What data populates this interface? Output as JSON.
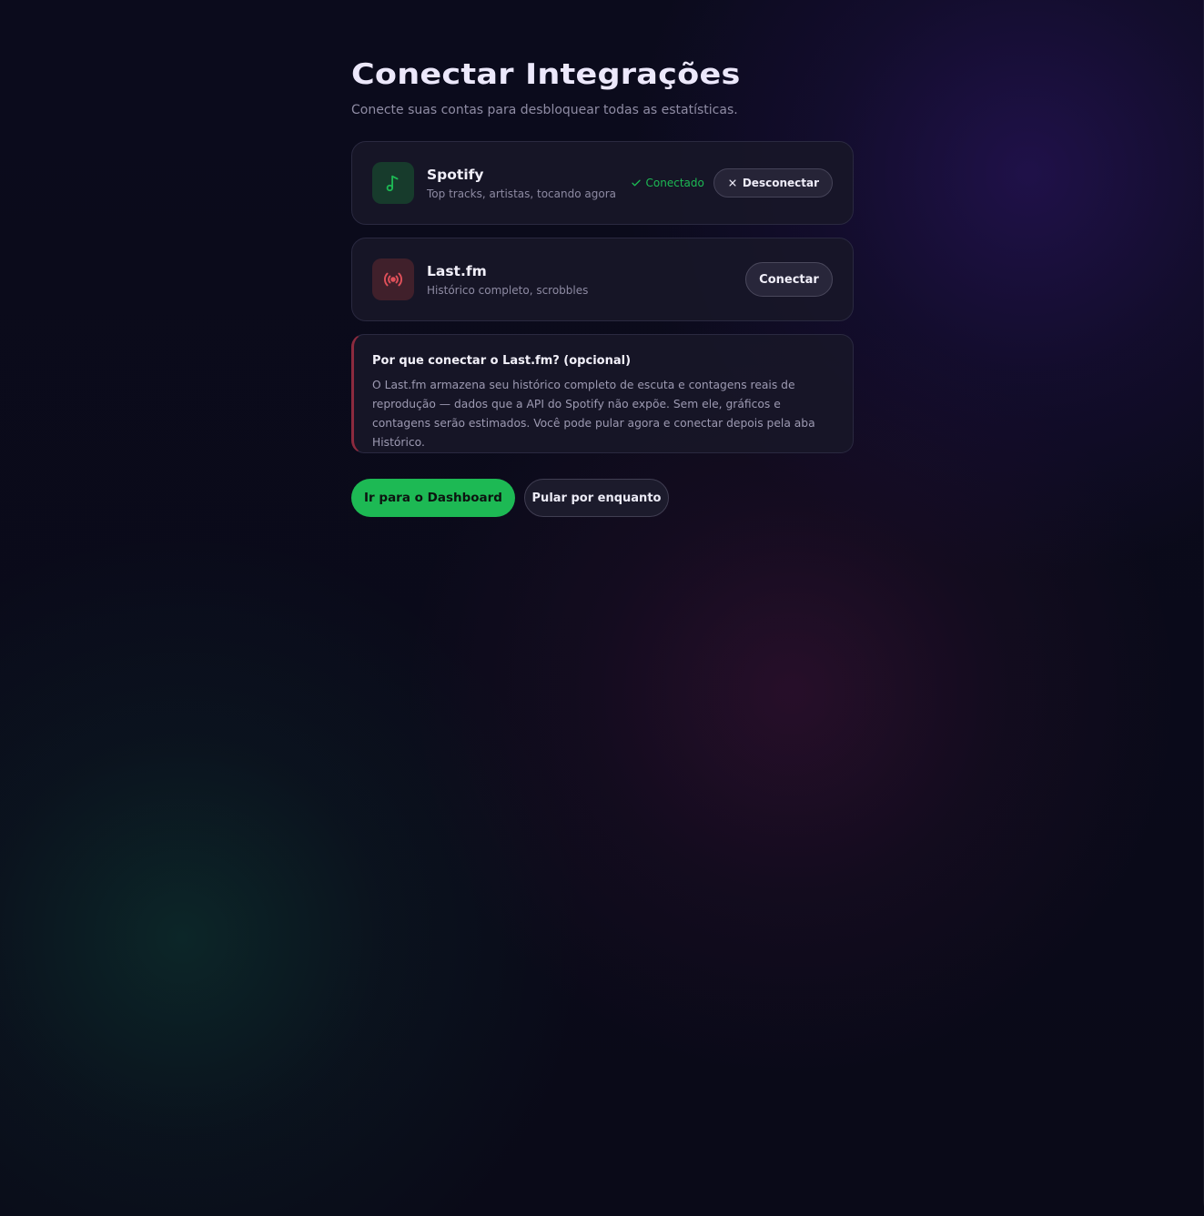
{
  "header": {
    "title": "Conectar Integrações",
    "subtitle": "Conecte suas contas para desbloquear todas as estatísticas."
  },
  "integrations": [
    {
      "name": "Spotify",
      "description": "Top tracks, artistas, tocando agora",
      "icon": "music-note-icon",
      "accent": "#1db954",
      "connected": true,
      "status_label": "Conectado",
      "action_label": "Desconectar"
    },
    {
      "name": "Last.fm",
      "description": "Histórico completo, scrobbles",
      "icon": "broadcast-icon",
      "accent": "#e0505a",
      "connected": false,
      "action_label": "Conectar"
    }
  ],
  "info": {
    "title": "Por que conectar o Last.fm? (opcional)",
    "body": "O Last.fm armazena seu histórico completo de escuta e contagens reais de reprodução — dados que a API do Spotify não expõe. Sem ele, gráficos e contagens serão estimados. Você pode pular agora e conectar depois pela aba Histórico."
  },
  "actions": {
    "primary_label": "Ir para o Dashboard",
    "secondary_label": "Pular por enquanto"
  },
  "colors": {
    "background": "#0a0a18",
    "primary": "#1db954",
    "info_accent": "#8c2a3e"
  }
}
